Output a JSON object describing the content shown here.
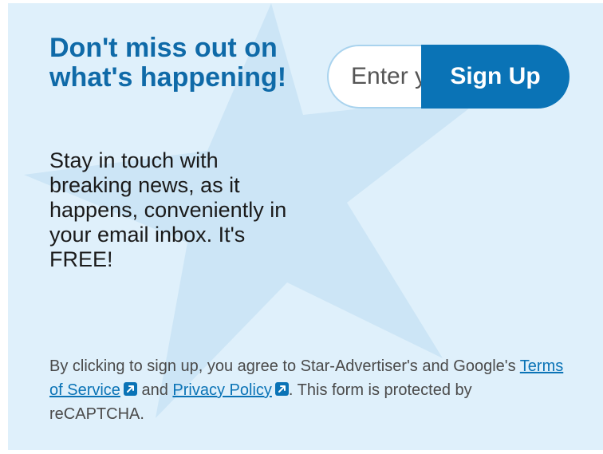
{
  "headline": "Don't miss out on what's happening!",
  "description": "Stay in touch with breaking news, as it happens, conveniently in your email inbox. It's FREE!",
  "form": {
    "email_placeholder": "Enter your email",
    "button_label": "Sign Up"
  },
  "legal": {
    "text_before": "By clicking to sign up, you agree to Star-Advertiser's and Google's ",
    "terms_label": "Terms of Service",
    "and_text": " and ",
    "privacy_label": "Privacy Policy",
    "text_after": ". This form is protected by reCAPTCHA."
  },
  "icons": {
    "background": "star-icon",
    "external_link": "external-link-icon"
  },
  "colors": {
    "panel_background": "#dff0fb",
    "headline": "#0f6aa8",
    "button": "#0a73b6",
    "link": "#0a73b6"
  }
}
